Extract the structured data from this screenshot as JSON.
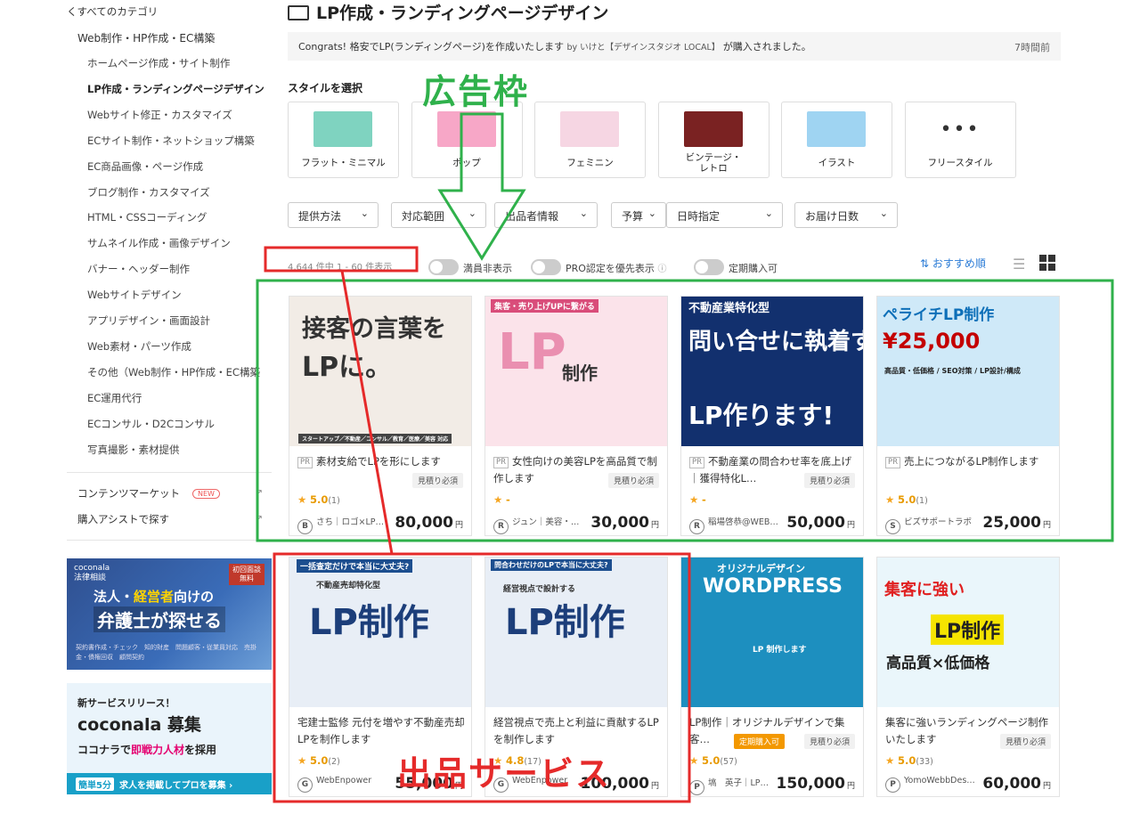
{
  "sidebar": {
    "back": "くすべてのカテゴリ",
    "parent": "Web制作・HP作成・EC構築",
    "items": [
      "ホームページ作成・サイト制作",
      "LP作成・ランディングページデザイン",
      "Webサイト修正・カスタマイズ",
      "ECサイト制作・ネットショップ構築",
      "EC商品画像・ページ作成",
      "ブログ制作・カスタマイズ",
      "HTML・CSSコーディング",
      "サムネイル作成・画像デザイン",
      "バナー・ヘッダー制作",
      "Webサイトデザイン",
      "アプリデザイン・画面設計",
      "Web素材・パーツ作成",
      "その他（Web制作・HP作成・EC構築",
      "EC運用代行",
      "ECコンサル・D2Cコンサル",
      "写真撮影・素材提供"
    ],
    "content_market": "コンテンツマーケット",
    "new_badge": "NEW",
    "assist": "購入アシストで探す",
    "ad1": {
      "logo": "coconala\n法律相談",
      "badge": "初回面談\n無料",
      "line1_pre": "法人・",
      "line1_hl": "経営者",
      "line1_post": "向けの",
      "line2": "弁護士が探せる",
      "tags": "契約書作成・チェック　知的財産　問題顧客・従業員対応　売掛金・債権回収　顧問契約"
    },
    "ad2": {
      "line1": "新サービスリリース！",
      "line2": "coconala 募集",
      "line3_pre": "ココナラで",
      "line3_hl": "即戦力人材",
      "line3_post": "を採用",
      "cta_badge": "簡単5分",
      "cta": "求人を掲載してプロを募集 ›"
    }
  },
  "header": {
    "title": "LP作成・ランディングページデザイン"
  },
  "notice": {
    "prefix": "Congrats!",
    "text": "格安でLP(ランディングページ)を作成いたします",
    "by": "by いけと【デザインスタジオ LOCAL】",
    "suffix": "が購入されました。",
    "time": "7時間前"
  },
  "styles": {
    "title": "スタイルを選択",
    "cards": [
      {
        "label": "フラット・ミニマル",
        "color": "#7fd3c0"
      },
      {
        "label": "ポップ",
        "color": "#f7a7c7"
      },
      {
        "label": "フェミニン",
        "color": "#f6d6e3"
      },
      {
        "label": "ビンテージ・レトロ",
        "color": "#7a2222"
      },
      {
        "label": "イラスト",
        "color": "#9fd4f2"
      },
      {
        "label": "フリースタイル",
        "dots": "•••"
      }
    ]
  },
  "filters": [
    "提供方法",
    "対応範囲",
    "出品者情報",
    "予算",
    "日時指定",
    "お届け日数"
  ],
  "results": {
    "count": "4,644 件中 1 - 60 件表示",
    "toggle1": "満員非表示",
    "toggle2": "PRO認定を優先表示",
    "toggle3": "定期購入可",
    "sort": "おすすめ順"
  },
  "ad_cards": [
    {
      "pr": "PR",
      "title": "素材支給でLPを形にします",
      "tag": "見積り必須",
      "rating": "5.0",
      "count": "(1)",
      "seller_initial": "B",
      "seller": "さち｜ロゴ×LP…",
      "price": "80,000",
      "yen": "円",
      "img": {
        "bg": "#f2ece6",
        "t1": "接客の言葉を",
        "t2": "LPに。",
        "t3": "スタートアップ／不動産／コンサル／教育／医療／美容 対応"
      }
    },
    {
      "pr": "PR",
      "title": "女性向けの美容LPを高品質で制作します",
      "tag": "見積り必須",
      "rating": "-",
      "count": "",
      "seller_initial": "R",
      "seller": "ジュン｜美容・…",
      "price": "30,000",
      "yen": "円",
      "img": {
        "bg": "#fbe3ea",
        "t1": "集客・売り上げUPに繋がる",
        "t2": "LP",
        "t3": "制作"
      }
    },
    {
      "pr": "PR",
      "title": "不動産業の問合わせ率を底上げ｜獲得特化L…",
      "tag": "見積り必須",
      "rating": "-",
      "count": "",
      "seller_initial": "R",
      "seller": "稲場啓恭@WEB…",
      "price": "50,000",
      "yen": "円",
      "img": {
        "bg": "#12306e",
        "t1": "不動産業特化型",
        "t2": "問い合せに執着する",
        "t3": "LP作ります!"
      }
    },
    {
      "pr": "PR",
      "title": "売上につながるLP制作します",
      "tag": "",
      "rating": "5.0",
      "count": "(1)",
      "seller_initial": "S",
      "seller": "ビズサポートラボ",
      "price": "25,000",
      "yen": "円",
      "img": {
        "bg": "#cfe9f8",
        "t1": "ペライチLP制作",
        "t2": "¥25,000",
        "t3": "高品質・低価格 / SEO対策 / LP設計/構成"
      }
    }
  ],
  "service_cards": [
    {
      "title": "宅建士監修 元付を増やす不動産売却LPを制作します",
      "tag": "",
      "tag2": "",
      "rating": "5.0",
      "count": "(2)",
      "seller_initial": "G",
      "seller": "WebEnpower",
      "price": "55,000",
      "yen": "円",
      "img": {
        "bg": "#e8eef6",
        "t1": "一括査定だけで本当に大丈夫?",
        "t2": "LP制作",
        "t3": "不動産売却特化型"
      }
    },
    {
      "title": "経営視点で売上と利益に貢献するLPを制作します",
      "tag": "",
      "tag2": "",
      "rating": "4.8",
      "count": "(17)",
      "seller_initial": "G",
      "seller": "WebEnpower",
      "price": "100,000",
      "yen": "円",
      "img": {
        "bg": "#e8eef6",
        "t1": "問合わせだけのLPで本当に大丈夫?",
        "t2": "LP制作",
        "t3": "経営視点で設計する"
      }
    },
    {
      "title": "LP制作｜オリジナルデザインで集客…",
      "tag": "見積り必須",
      "tag2": "定期購入可",
      "rating": "5.0",
      "count": "(57)",
      "seller_initial": "P",
      "seller": "塙　英子｜LP…",
      "price": "150,000",
      "yen": "円",
      "img": {
        "bg": "#1d8fbf",
        "t1": "オリジナルデザイン",
        "t2": "WORDPRESS",
        "t3": "LP 制作します"
      }
    },
    {
      "title": "集客に強いランディングページ制作いたします",
      "tag": "見積り必須",
      "tag2": "",
      "rating": "5.0",
      "count": "(33)",
      "seller_initial": "P",
      "seller": "YomoWebbDes…",
      "price": "60,000",
      "yen": "円",
      "img": {
        "bg": "#eaf6fb",
        "t1": "集客に強い",
        "t2": "LP制作",
        "t3": "高品質×低価格"
      }
    }
  ],
  "annotations": {
    "ad_label": "広告枠",
    "service_label": "出品サービス",
    "green": "#2fb14b",
    "red": "#e52a2a"
  }
}
